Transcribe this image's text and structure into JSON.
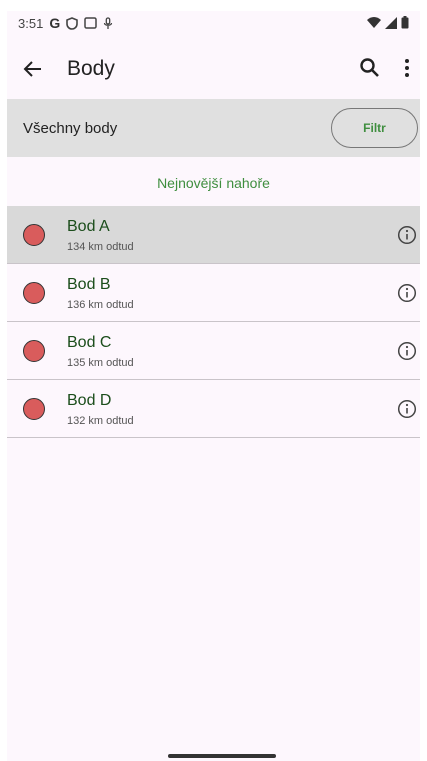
{
  "status_bar": {
    "time": "3:51",
    "google_letter": "G"
  },
  "app_bar": {
    "title": "Body"
  },
  "filter_bar": {
    "label": "Všechny body",
    "filter_button": "Filtr"
  },
  "sort_label": "Nejnovější nahoře",
  "points": [
    {
      "name": "Bod A",
      "distance": "134 km odtud"
    },
    {
      "name": "Bod B",
      "distance": "136 km odtud"
    },
    {
      "name": "Bod C",
      "distance": "135 km odtud"
    },
    {
      "name": "Bod D",
      "distance": "132 km odtud"
    }
  ],
  "colors": {
    "accent_green": "#3f8e3f",
    "marker_red": "#d95c5c",
    "background": "#fdf7fd",
    "filter_bar_bg": "#e0e0e0"
  },
  "icons": {
    "back": "arrow-left-icon",
    "search": "search-icon",
    "more": "more-vert-icon",
    "info": "info-icon"
  }
}
